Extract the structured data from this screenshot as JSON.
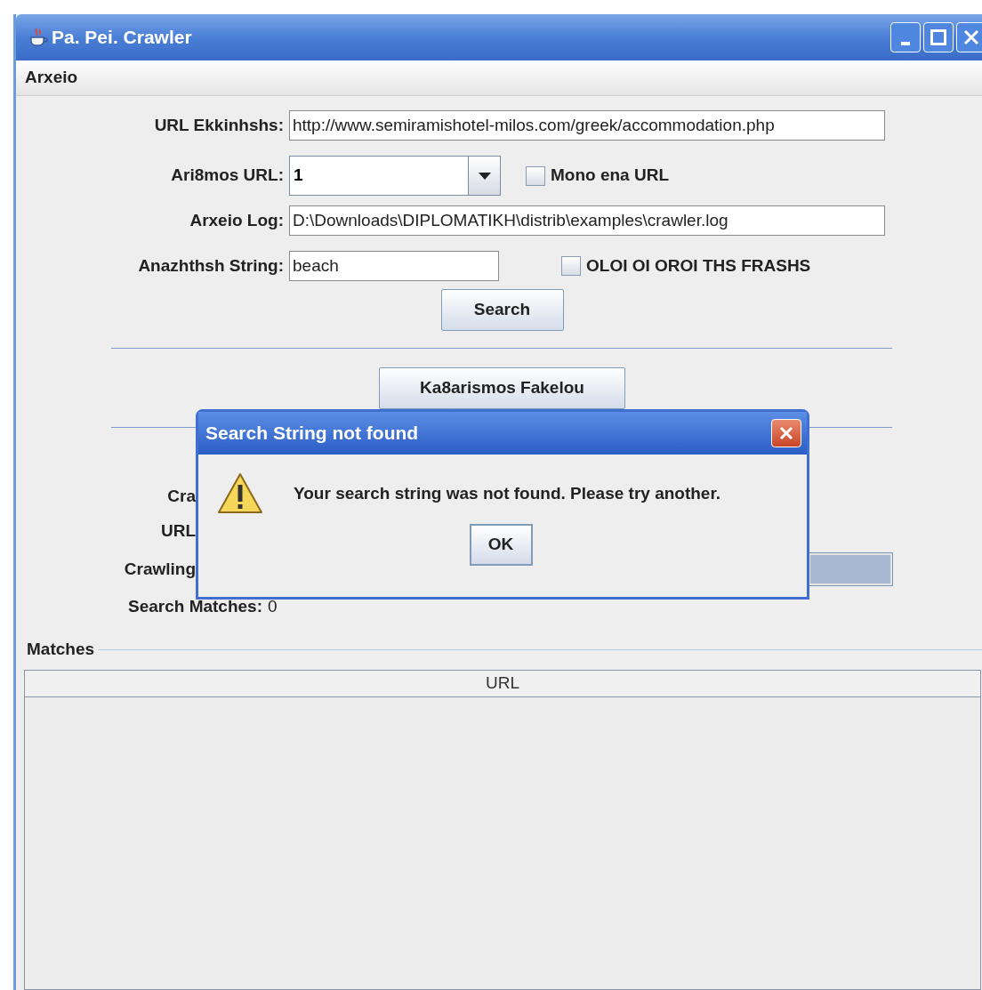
{
  "window": {
    "title": "Pa. Pei. Crawler"
  },
  "menu": [
    "Arxeio"
  ],
  "form": [
    {
      "kind": "text",
      "label": "URL Ekkinhshs:",
      "value": "http://www.semiramishotel-milos.com/greek/accommodation.php"
    },
    {
      "kind": "combo",
      "label": "Ari8mos URL:",
      "value": "1",
      "option": {
        "label": "Mono ena URL",
        "checked": false
      }
    },
    {
      "kind": "text",
      "label": "Arxeio Log:",
      "value": "D:\\Downloads\\DIPLOMATIKH\\distrib\\examples\\crawler.log"
    },
    {
      "kind": "text",
      "label": "Anazhthsh String:",
      "value": "beach",
      "option": {
        "label": "OLOI OI OROI THS FRASHS",
        "checked": false
      }
    }
  ],
  "search_button": "Search",
  "clear_button": "Ka8arismos Fakelou",
  "status": [
    {
      "kind": "plain",
      "label": "Cra"
    },
    {
      "kind": "plain",
      "label": "URL"
    },
    {
      "kind": "progress",
      "label": "Crawling",
      "level": 1
    },
    {
      "kind": "value",
      "label": "Search Matches:",
      "value": "0"
    }
  ],
  "matches": {
    "title": "Matches",
    "columns": [
      "URL"
    ]
  },
  "dialog": {
    "title": "Search String not found",
    "message": "Your search string was not found. Please try another.",
    "button": "OK"
  }
}
